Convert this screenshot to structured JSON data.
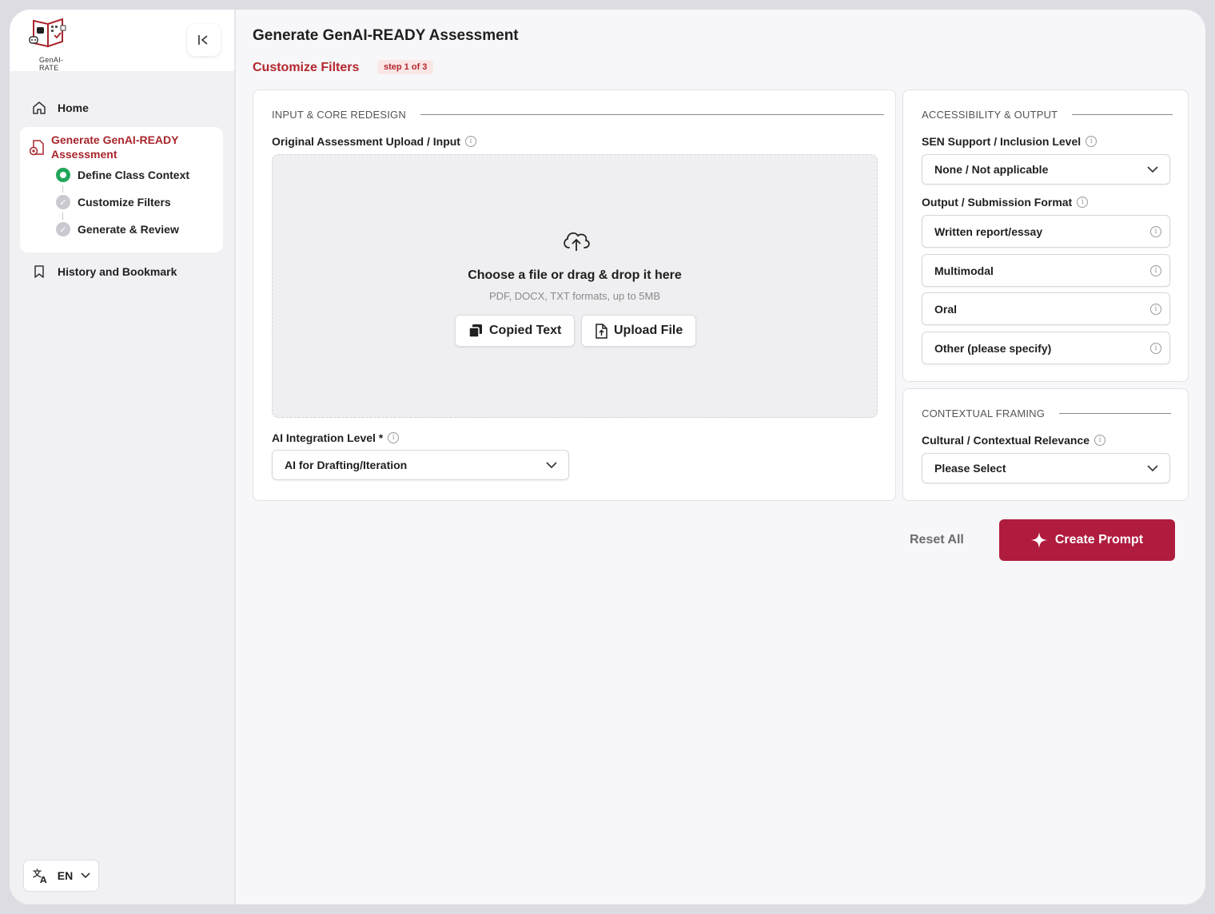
{
  "app": {
    "logo_text": "GenAI-RATE",
    "accent_color": "#b3262e",
    "primary_button_color": "#b01c3e"
  },
  "sidebar": {
    "home_label": "Home",
    "group_title": "Generate GenAI-READY Assessment",
    "steps": [
      {
        "label": "Define Class Context",
        "state": "active"
      },
      {
        "label": "Customize Filters",
        "state": "pending"
      },
      {
        "label": "Generate & Review",
        "state": "pending"
      }
    ],
    "history_label": "History and Bookmark",
    "language": "EN"
  },
  "header": {
    "title": "Generate GenAI-READY Assessment",
    "subtitle": "Customize Filters",
    "step_badge": "step 1 of 3"
  },
  "input_section": {
    "heading": "INPUT & CORE REDESIGN",
    "upload_label": "Original Assessment Upload / Input",
    "dropzone_title": "Choose a file or drag & drop it here",
    "dropzone_hint": "PDF, DOCX, TXT formats, up to 5MB",
    "copied_text_button": "Copied Text",
    "upload_file_button": "Upload File",
    "ai_level_label": "AI Integration Level *",
    "ai_level_value": "AI for Drafting/Iteration"
  },
  "accessibility_section": {
    "heading": "ACCESSIBILITY & OUTPUT",
    "sen_label": "SEN Support / Inclusion Level",
    "sen_value": "None / Not applicable",
    "format_label": "Output / Submission Format",
    "formats": [
      "Written report/essay",
      "Multimodal",
      "Oral",
      "Other (please specify)"
    ]
  },
  "contextual_section": {
    "heading": "CONTEXTUAL FRAMING",
    "cultural_label": "Cultural / Contextual Relevance",
    "cultural_value": "Please Select"
  },
  "actions": {
    "reset": "Reset All",
    "create": "Create Prompt"
  }
}
